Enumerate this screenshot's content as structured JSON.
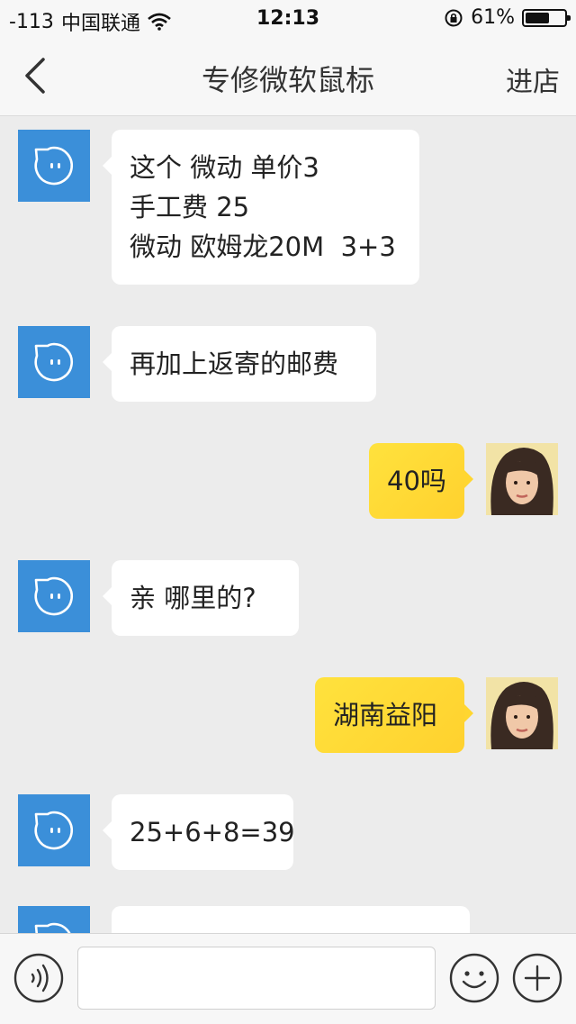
{
  "status_bar": {
    "signal": "-113",
    "carrier": "中国联通",
    "time": "12:13",
    "battery_percent": "61%",
    "battery_level": 0.61
  },
  "nav": {
    "title": "专修微软鼠标",
    "action_label": "进店"
  },
  "messages": [
    {
      "side": "left",
      "text": "这个 微动 单价3\n手工费 25\n微动 欧姆龙20M  3+3"
    },
    {
      "side": "left",
      "text": "再加上返寄的邮费"
    },
    {
      "side": "right",
      "text": "40吗"
    },
    {
      "side": "left",
      "text": "亲 哪里的?"
    },
    {
      "side": "right",
      "text": "湖南益阳"
    },
    {
      "side": "left",
      "text": "25+6+8=39"
    },
    {
      "side": "left",
      "text": ""
    }
  ],
  "input": {
    "value": "",
    "placeholder": ""
  },
  "colors": {
    "bot_avatar": "#3b8fd9",
    "user_bubble": "#ffd830",
    "background": "#ececec"
  },
  "icons": {
    "back": "chevron-left-icon",
    "voice": "voice-icon",
    "emoji": "smiley-icon",
    "more": "plus-icon"
  }
}
